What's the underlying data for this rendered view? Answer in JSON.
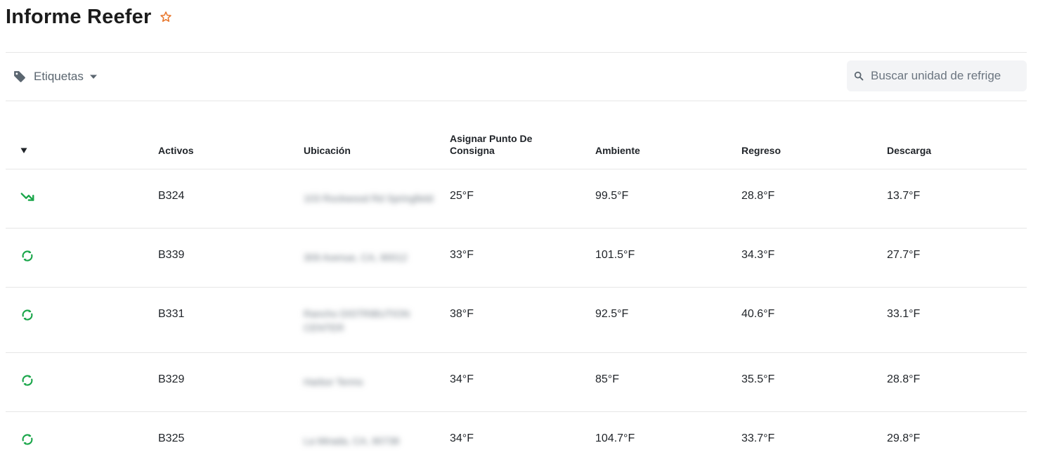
{
  "page": {
    "title": "Informe Reefer"
  },
  "toolbar": {
    "tags_label": "Etiquetas",
    "search_placeholder": "Buscar unidad de refrige"
  },
  "table": {
    "headers": {
      "asset": "Activos",
      "location": "Ubicación",
      "setpoint": "Asignar Punto De Consigna",
      "ambient": "Ambiente",
      "return": "Regreso",
      "discharge": "Descarga"
    },
    "rows": [
      {
        "status_icon": "trending-down-icon",
        "asset": "B324",
        "location": "103 Rockwood Rd Springfield",
        "setpoint": "25°F",
        "ambient": "99.5°F",
        "return": "28.8°F",
        "discharge": "13.7°F"
      },
      {
        "status_icon": "sync-icon",
        "asset": "B339",
        "location": "309 Avenue, CA, 90012",
        "setpoint": "33°F",
        "ambient": "101.5°F",
        "return": "34.3°F",
        "discharge": "27.7°F"
      },
      {
        "status_icon": "sync-icon",
        "asset": "B331",
        "location": "Rancho DISTRIBUTION CENTER",
        "setpoint": "38°F",
        "ambient": "92.5°F",
        "return": "40.6°F",
        "discharge": "33.1°F"
      },
      {
        "status_icon": "sync-icon",
        "asset": "B329",
        "location": "Harbor Terms",
        "setpoint": "34°F",
        "ambient": "85°F",
        "return": "35.5°F",
        "discharge": "28.8°F"
      },
      {
        "status_icon": "sync-icon",
        "asset": "B325",
        "location": "La Mirada, CA, 90738",
        "setpoint": "34°F",
        "ambient": "104.7°F",
        "return": "33.7°F",
        "discharge": "29.8°F"
      }
    ]
  },
  "colors": {
    "accent_star": "#e8762b",
    "status_green": "#1aa64a",
    "muted_text": "#5b6670",
    "divider": "#e6e6e6"
  }
}
